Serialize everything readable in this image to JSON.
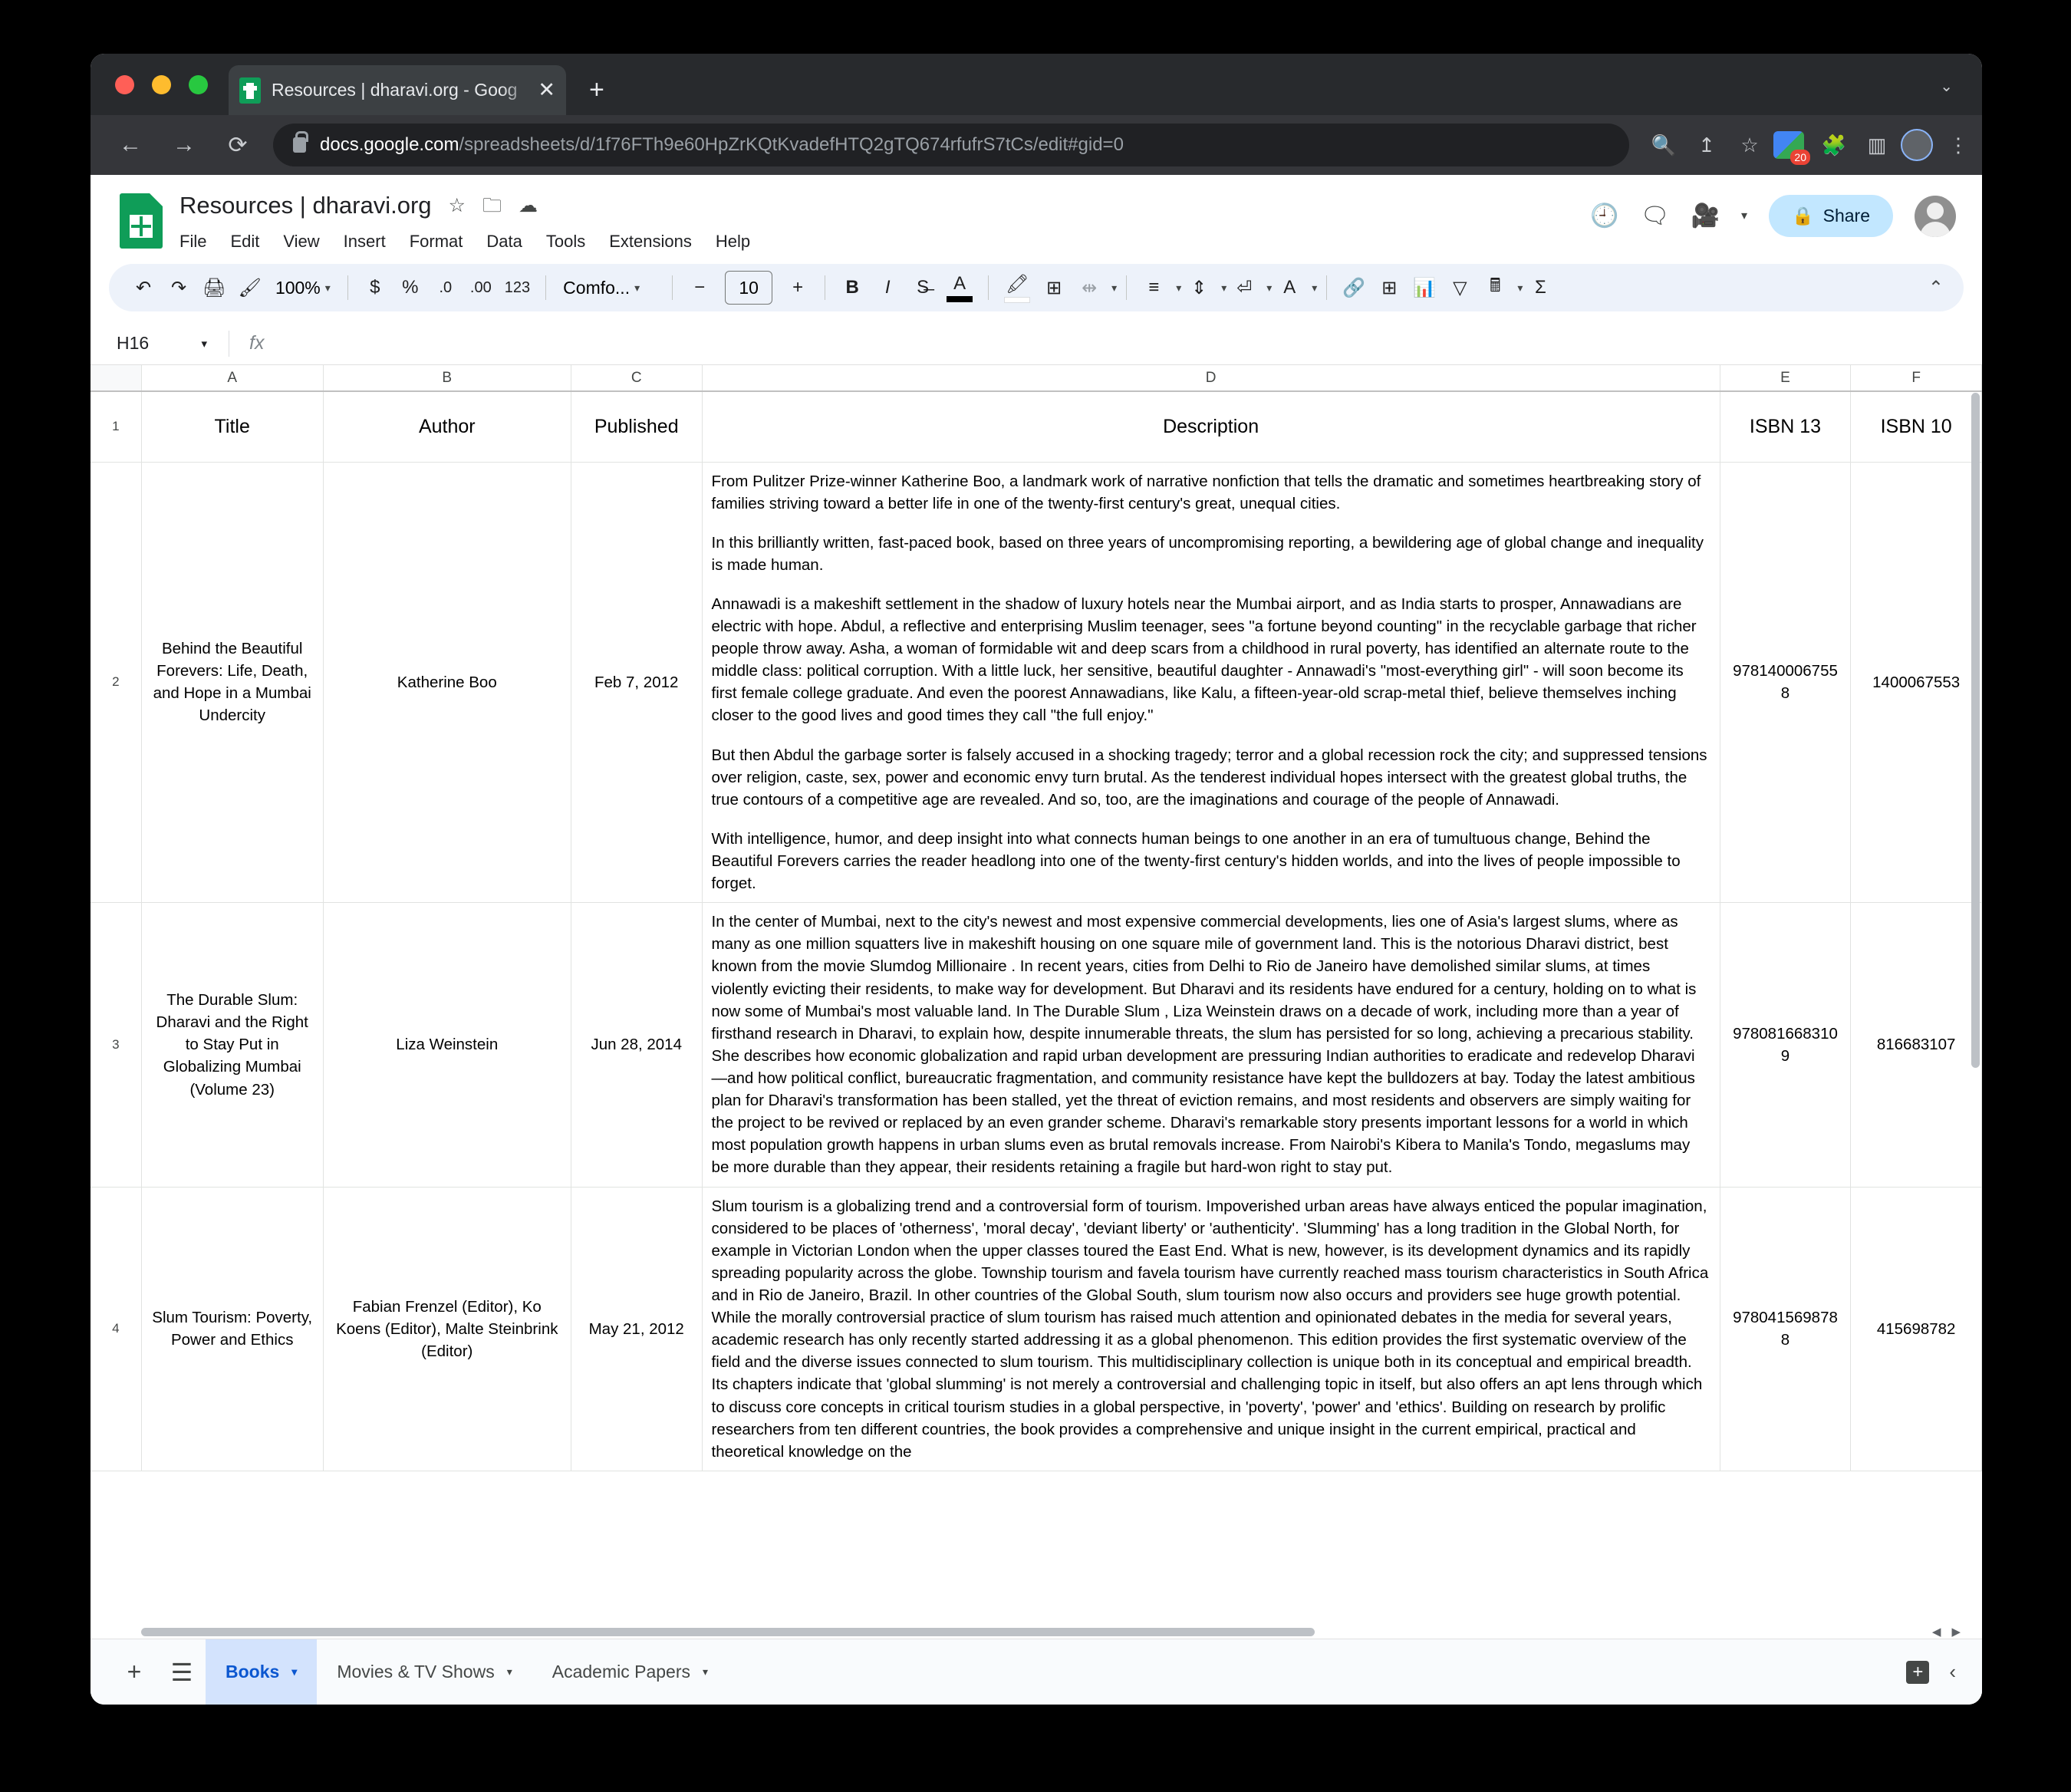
{
  "browser": {
    "tab_title": "Resources | dharavi.org - Goog",
    "tab_close_glyph": "✕",
    "new_tab_glyph": "+",
    "tab_strip_chevron": "⌄",
    "back_glyph": "←",
    "forward_glyph": "→",
    "reload_glyph": "⟳",
    "url_host": "docs.google.com",
    "url_path": "/spreadsheets/d/1f76FTh9e60HpZrKQtKvadefHTQ2gTQ674rfufrS7tCs/edit#gid=0",
    "search_glyph": "🔍",
    "share_glyph": "↥",
    "bookmark_glyph": "☆",
    "ext_badge_count": "20",
    "puzzle_glyph": "🧩",
    "sidepanel_glyph": "▥",
    "menu_glyph": "⋮"
  },
  "sheets": {
    "doc_title": "Resources | dharavi.org",
    "star_glyph": "☆",
    "move_glyph": "🗀",
    "cloud_glyph": "☁",
    "menus": [
      "File",
      "Edit",
      "View",
      "Insert",
      "Format",
      "Data",
      "Tools",
      "Extensions",
      "Help"
    ],
    "history_glyph": "🕘",
    "comment_glyph": "🗨",
    "meet_glyph": "🎥",
    "meet_caret": "▾",
    "share_label": "Share",
    "share_icon": "🔒"
  },
  "toolbar": {
    "undo": "↶",
    "redo": "↷",
    "print": "🖨",
    "paint_format": "🖌",
    "zoom_value": "100%",
    "caret": "▾",
    "currency": "$",
    "percent": "%",
    "decrease_decimal": ".0",
    "increase_decimal": ".00",
    "more_formats": "123",
    "font_name": "Comfo...",
    "font_size_minus": "−",
    "font_size": "10",
    "font_size_plus": "+",
    "bold": "B",
    "italic": "I",
    "strikethrough": "S̶",
    "text_color": "A",
    "fill_color": "🖍",
    "borders": "⊞",
    "merge_cells": "⇹",
    "horizontal_align": "≡",
    "vertical_align": "⇕",
    "text_wrap": "⏎",
    "text_rotation": "A",
    "insert_link": "🔗",
    "insert_comment": "⊞",
    "insert_chart": "📊",
    "create_filter": "▽",
    "functions": "🖩",
    "sum": "Σ",
    "collapse": "⌃"
  },
  "formula_bar": {
    "name_box": "H16",
    "name_box_caret": "▾",
    "fx_label": "fx",
    "formula_value": ""
  },
  "grid": {
    "column_letters": [
      "A",
      "B",
      "C",
      "D",
      "E",
      "F"
    ],
    "row_numbers": [
      "1",
      "2",
      "3",
      "4"
    ],
    "headers": [
      "Title",
      "Author",
      "Published",
      "Description",
      "ISBN 13",
      "ISBN 10"
    ],
    "rows": [
      {
        "title": "Behind the Beautiful Forevers: Life, Death, and Hope in a Mumbai Undercity",
        "author": "Katherine Boo",
        "published": "Feb 7, 2012",
        "description_paragraphs": [
          "From Pulitzer Prize-winner Katherine Boo, a landmark work of narrative nonfiction that tells the dramatic and sometimes heartbreaking story of families striving toward a better life in one of the twenty-first century's great, unequal cities.",
          "In this brilliantly written, fast-paced book, based on three years of uncompromising reporting, a bewildering age of global change and inequality is made human.",
          "Annawadi is a makeshift settlement in the shadow of luxury hotels near the Mumbai airport, and as India starts to prosper, Annawadians are electric with hope. Abdul, a reflective and enterprising Muslim teenager, sees \"a fortune beyond counting\" in the recyclable garbage that richer people throw away. Asha, a woman of formidable wit and deep scars from a childhood in rural poverty, has identified an alternate route to the middle class: political corruption. With a little luck, her sensitive, beautiful daughter - Annawadi's \"most-everything girl\" - will soon become its first female college graduate. And even the poorest Annawadians, like Kalu, a fifteen-year-old scrap-metal thief, believe themselves inching closer to the good lives and good times they call \"the full enjoy.\"",
          "But then Abdul the garbage sorter is falsely accused in a shocking tragedy; terror and a global recession rock the city; and suppressed tensions over religion, caste, sex, power and economic envy turn brutal. As the tenderest individual hopes intersect with the greatest global truths, the true contours of a competitive age are revealed. And so, too, are the imaginations and courage of the people of Annawadi.",
          "With intelligence, humor, and deep insight into what connects human beings to one another in an era of tumultuous change, Behind the Beautiful Forevers carries the reader headlong into one of the twenty-first century's hidden worlds, and into the lives of people impossible to forget."
        ],
        "isbn13": "9781400067558",
        "isbn10": "1400067553"
      },
      {
        "title": "The Durable Slum: Dharavi and the Right to Stay Put in Globalizing Mumbai (Volume 23)",
        "author": "Liza Weinstein",
        "published": "Jun 28, 2014",
        "description_paragraphs": [
          "In the center of Mumbai, next to the city's newest and most expensive commercial developments, lies one of Asia's largest slums, where as many as one million squatters live in makeshift housing on one square mile of government land. This is the notorious Dharavi district, best known from the movie Slumdog Millionaire . In recent years, cities from Delhi to Rio de Janeiro have demolished similar slums, at times violently evicting their residents, to make way for development. But Dharavi and its residents have endured for a century, holding on to what is now some of Mumbai's most valuable land. In The Durable Slum , Liza Weinstein draws on a decade of work, including more than a year of firsthand research in Dharavi, to explain how, despite innumerable threats, the slum has persisted for so long, achieving a precarious stability. She describes how economic globalization and rapid urban development are pressuring Indian authorities to eradicate and redevelop Dharavi—and how political conflict, bureaucratic fragmentation, and community resistance have kept the bulldozers at bay. Today the latest ambitious plan for Dharavi's transformation has been stalled, yet the threat of eviction remains, and most residents and observers are simply waiting for the project to be revived or replaced by an even grander scheme. Dharavi's remarkable story presents important lessons for a world in which most population growth happens in urban slums even as brutal removals increase. From Nairobi's Kibera to Manila's Tondo, megaslums may be more durable than they appear, their residents retaining a fragile but hard-won right to stay put."
        ],
        "isbn13": "9780816683109",
        "isbn10": "816683107"
      },
      {
        "title": "Slum Tourism: Poverty, Power and Ethics",
        "author": "Fabian Frenzel (Editor), Ko Koens (Editor), Malte Steinbrink (Editor)",
        "published": "May 21, 2012",
        "description_paragraphs": [
          "Slum tourism is a globalizing trend and a controversial form of tourism. Impoverished urban areas have always enticed the popular imagination, considered to be places of 'otherness', 'moral decay', 'deviant liberty' or 'authenticity'. 'Slumming' has a long tradition in the Global North, for example in Victorian London when the upper classes toured the East End. What is new, however, is its development dynamics and its rapidly spreading popularity across the globe. Township tourism and favela tourism have currently reached mass tourism characteristics in South Africa and in Rio de Janeiro, Brazil. In other countries of the Global South, slum tourism now also occurs and providers see huge growth potential. While the morally controversial practice of slum tourism has raised much attention and opinionated debates in the media for several years, academic research has only recently started addressing it as a global phenomenon. This edition provides the first systematic overview of the field and the diverse issues connected to slum tourism. This multidisciplinary collection is unique both in its conceptual and empirical breadth. Its chapters indicate that 'global slumming' is not merely a controversial and challenging topic in itself, but also offers an apt lens through which to discuss core concepts in critical tourism studies in a global perspective, in 'poverty', 'power' and 'ethics'. Building on research by prolific researchers from ten different countries, the book provides a comprehensive and unique insight in the current empirical, practical and theoretical knowledge on the"
        ],
        "isbn13": "9780415698788",
        "isbn10": "415698782"
      }
    ]
  },
  "sheet_bar": {
    "add_sheet_glyph": "+",
    "all_sheets_glyph": "☰",
    "tabs": [
      {
        "label": "Books",
        "caret": "▾",
        "active": true
      },
      {
        "label": "Movies & TV Shows",
        "caret": "▾",
        "active": false
      },
      {
        "label": "Academic Papers",
        "caret": "▾",
        "active": false
      }
    ],
    "explore_glyph": "+",
    "collapse_glyph": "‹"
  }
}
